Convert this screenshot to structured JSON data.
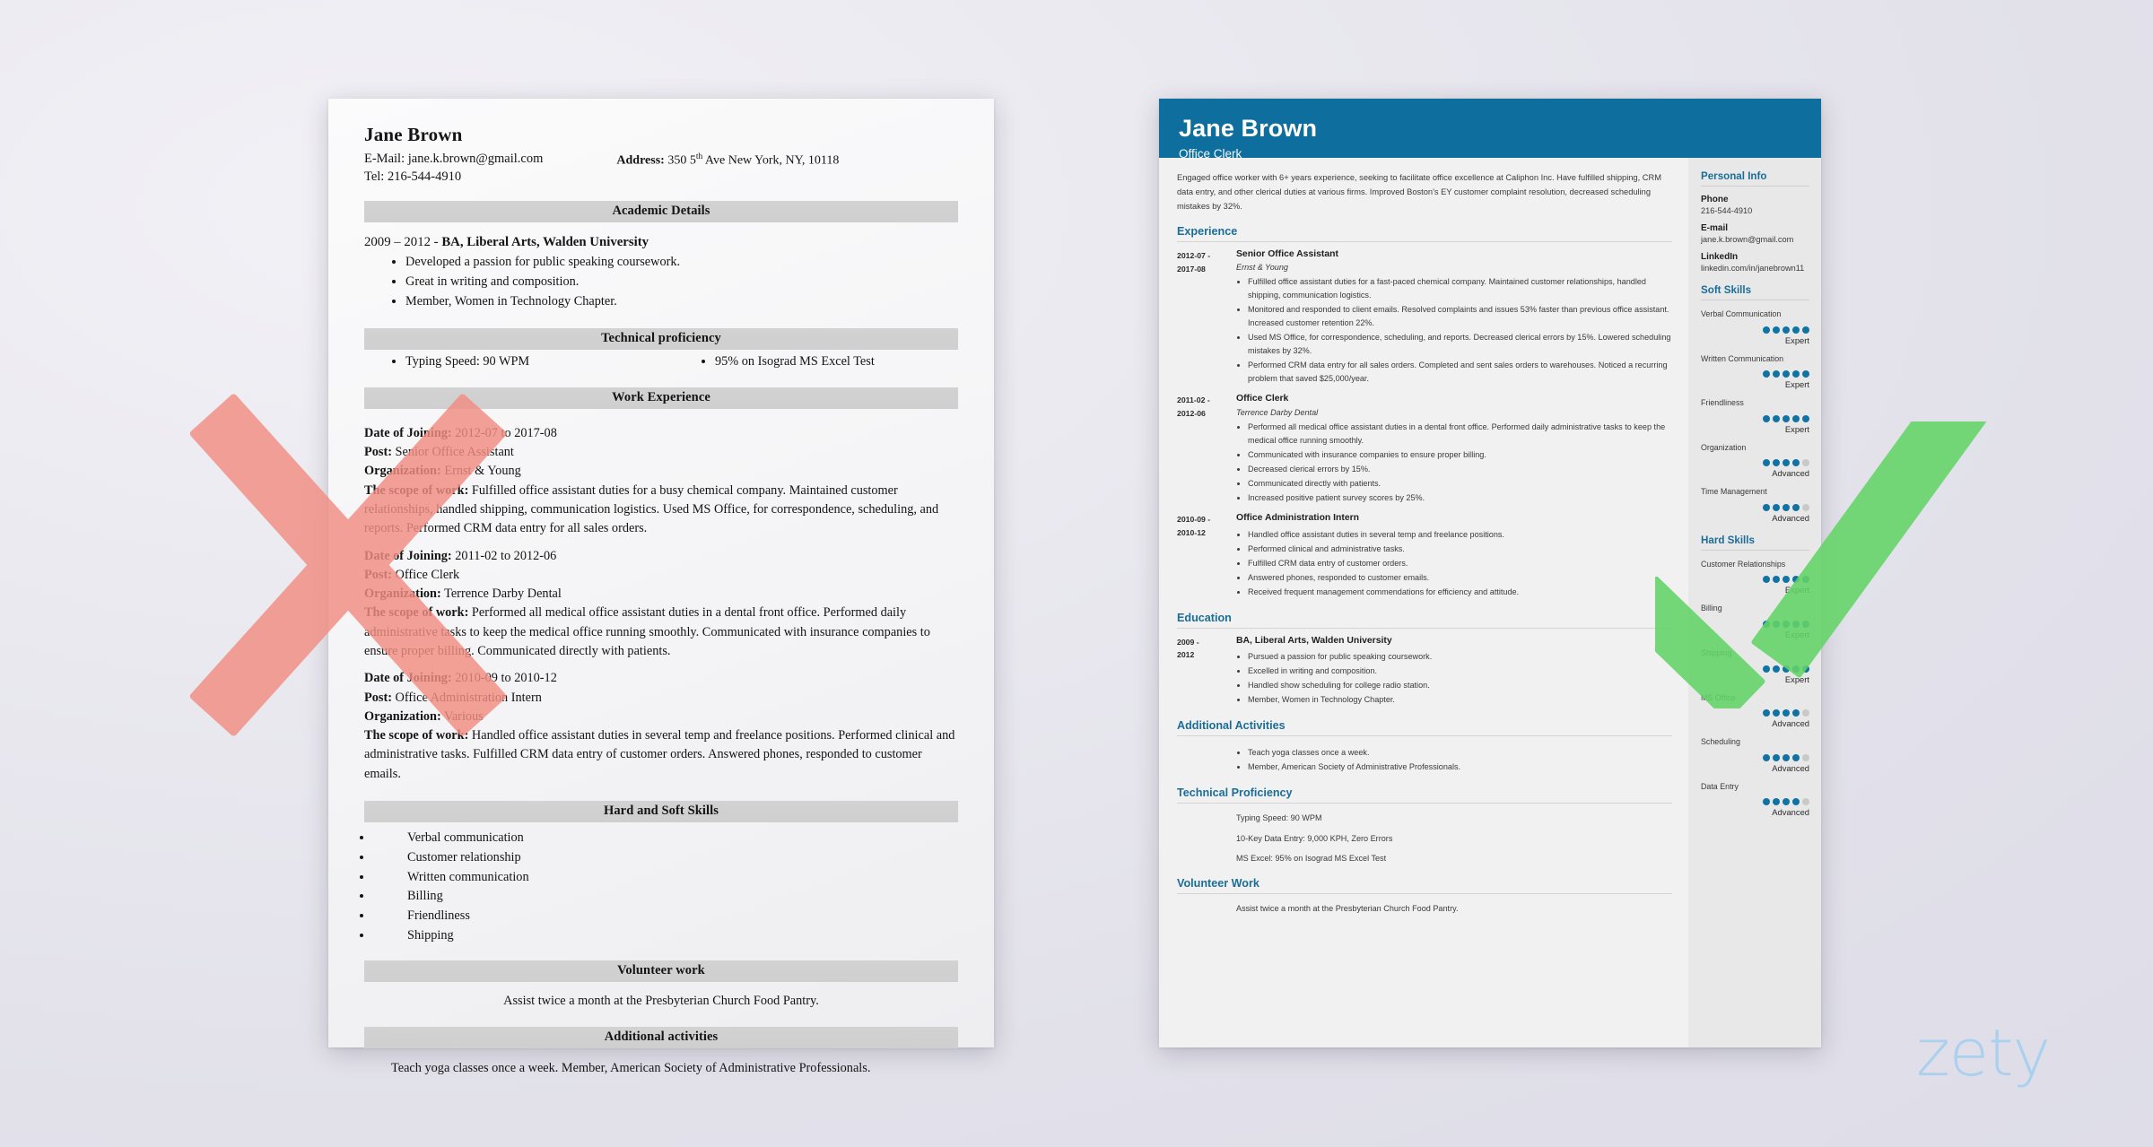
{
  "colors": {
    "header_blue": "#0e6e9e",
    "accent_blue": "#1b6d96",
    "dot_blue": "#1173a4",
    "dot_off": "#c9c9c9",
    "cross_red": "#f28e82",
    "check_green": "#63d467",
    "watermark_blue": "#9bcdef"
  },
  "watermark": {
    "text": "zety"
  },
  "bad_resume": {
    "name": "Jane Brown",
    "email_line": "E-Mail: jane.k.brown@gmail.com",
    "tel_line": "Tel: 216-544-4910",
    "address_label": "Address:",
    "address_value_a": "350 5",
    "address_value_sup": "th",
    "address_value_b": " Ave New York, NY, 10118",
    "sections": {
      "academic": "Academic Details",
      "technical": "Technical proficiency",
      "work": "Work Experience",
      "skills": "Hard and Soft Skills",
      "volunteer": "Volunteer work",
      "additional": "Additional activities"
    },
    "education": {
      "years": "2009 – 2012 - ",
      "degree": "BA, Liberal Arts, Walden University",
      "bullets": [
        "Developed a passion for public speaking coursework.",
        "Great in writing and composition.",
        "Member, Women in Technology Chapter."
      ]
    },
    "technical": {
      "left": [
        "Typing Speed: 90 WPM"
      ],
      "right": [
        "95% on Isograd MS Excel Test"
      ]
    },
    "jobs": [
      {
        "date_label": "Date of Joining:",
        "date_value": " 2012-07 to 2017-08",
        "post_label": "Post:",
        "post_value": " Senior Office Assistant",
        "org_label": "Organization:",
        "org_value": " Ernst & Young",
        "scope_label": "The scope of work:",
        "scope_value": " Fulfilled office assistant duties for a busy chemical company. Maintained customer relationships, handled shipping, communication logistics. Used MS Office, for correspondence, scheduling, and reports. Performed CRM data entry for all sales orders."
      },
      {
        "date_label": "Date of Joining:",
        "date_value": " 2011-02 to 2012-06",
        "post_label": "Post:",
        "post_value": " Office Clerk",
        "org_label": "Organization:",
        "org_value": " Terrence Darby Dental",
        "scope_label": "The scope of work:",
        "scope_value": " Performed all medical office assistant duties in a dental front office. Performed daily administrative tasks to keep the medical office running smoothly. Communicated with insurance companies to ensure proper billing. Communicated directly with patients."
      },
      {
        "date_label": "Date of Joining:",
        "date_value": " 2010-09 to 2010-12",
        "post_label": "Post:",
        "post_value": " Office Administration Intern",
        "org_label": "Organization:",
        "org_value": " Various",
        "scope_label": "The scope of work:",
        "scope_value": " Handled office assistant duties in several temp and freelance positions. Performed clinical and administrative tasks. Fulfilled CRM data entry of customer orders. Answered phones, responded to customer emails."
      }
    ],
    "skills": [
      "Verbal communication",
      "Customer relationship",
      "Written communication",
      "Billing",
      "Friendliness",
      "Shipping"
    ],
    "volunteer_text": "Assist twice a month at the Presbyterian Church Food Pantry.",
    "additional_text": "Teach yoga classes once a week. Member, American Society of Administrative Professionals."
  },
  "good_resume": {
    "name": "Jane Brown",
    "role": "Office Clerk",
    "summary": "Engaged office worker with 6+ years experience, seeking to facilitate office excellence at Caliphon Inc. Have fulfilled shipping, CRM data entry, and other clerical duties at various firms. Improved Boston's EY customer complaint resolution, decreased scheduling mistakes by 32%.",
    "sections": {
      "experience": "Experience",
      "education": "Education",
      "additional_activities": "Additional Activities",
      "technical_proficiency": "Technical Proficiency",
      "volunteer_work": "Volunteer Work"
    },
    "experience": [
      {
        "date_from": "2012-07 -",
        "date_to": "2017-08",
        "title": "Senior Office Assistant",
        "org": "Ernst & Young",
        "bullets": [
          "Fulfilled office assistant duties for a fast-paced chemical company. Maintained customer relationships, handled shipping, communication logistics.",
          "Monitored and responded to client emails. Resolved complaints and issues 53% faster than previous office assistant. Increased customer retention 22%.",
          "Used MS Office, for correspondence, scheduling, and reports. Decreased clerical errors by 15%. Lowered scheduling mistakes by 32%.",
          "Performed CRM data entry for all sales orders. Completed and sent sales orders to warehouses. Noticed a recurring problem that saved $25,000/year."
        ]
      },
      {
        "date_from": "2011-02 -",
        "date_to": "2012-06",
        "title": "Office Clerk",
        "org": "Terrence Darby Dental",
        "bullets": [
          "Performed all medical office assistant duties in a dental front office. Performed daily administrative tasks to keep the medical office running smoothly.",
          "Communicated with insurance companies to ensure proper billing.",
          "Decreased clerical errors by 15%.",
          "Communicated directly with patients.",
          "Increased positive patient survey scores by 25%."
        ]
      },
      {
        "date_from": "2010-09 -",
        "date_to": "2010-12",
        "title": "Office Administration Intern",
        "org": "",
        "bullets": [
          "Handled office assistant duties in several temp and freelance positions.",
          "Performed clinical and administrative tasks.",
          "Fulfilled CRM data entry of customer orders.",
          "Answered phones, responded to customer emails.",
          "Received frequent management commendations for efficiency and attitude."
        ]
      }
    ],
    "education": [
      {
        "date_from": "2009 -",
        "date_to": "2012",
        "title": "BA, Liberal Arts, Walden University",
        "org": "",
        "bullets": [
          "Pursued a passion for public speaking coursework.",
          "Excelled in writing and composition.",
          "Handled show scheduling for college radio station.",
          "Member, Women in Technology Chapter."
        ]
      }
    ],
    "additional_activities": [
      "Teach yoga classes once a week.",
      "Member, American Society of Administrative Professionals."
    ],
    "technical_proficiency": [
      "Typing Speed: 90 WPM",
      "10-Key Data Entry: 9,000 KPH, Zero Errors",
      "MS Excel: 95% on Isograd MS Excel Test"
    ],
    "volunteer_work": [
      "Assist twice a month at the Presbyterian Church Food Pantry."
    ],
    "sidebar": {
      "personal_info_title": "Personal Info",
      "personal_info": [
        {
          "label": "Phone",
          "value": "216-544-4910"
        },
        {
          "label": "E-mail",
          "value": "jane.k.brown@gmail.com"
        },
        {
          "label": "LinkedIn",
          "value": "linkedin.com/in/janebrown11"
        }
      ],
      "soft_skills_title": "Soft Skills",
      "soft_skills": [
        {
          "name": "Verbal Communication",
          "filled": 5,
          "total": 5,
          "level": "Expert"
        },
        {
          "name": "Written Communication",
          "filled": 5,
          "total": 5,
          "level": "Expert"
        },
        {
          "name": "Friendliness",
          "filled": 5,
          "total": 5,
          "level": "Expert"
        },
        {
          "name": "Organization",
          "filled": 4,
          "total": 5,
          "level": "Advanced"
        },
        {
          "name": "Time Management",
          "filled": 4,
          "total": 5,
          "level": "Advanced"
        }
      ],
      "hard_skills_title": "Hard Skills",
      "hard_skills": [
        {
          "name": "Customer Relationships",
          "filled": 5,
          "total": 5,
          "level": "Expert"
        },
        {
          "name": "Billing",
          "filled": 5,
          "total": 5,
          "level": "Expert"
        },
        {
          "name": "Shipping",
          "filled": 5,
          "total": 5,
          "level": "Expert"
        },
        {
          "name": "MS Office",
          "filled": 4,
          "total": 5,
          "level": "Advanced"
        },
        {
          "name": "Scheduling",
          "filled": 4,
          "total": 5,
          "level": "Advanced"
        },
        {
          "name": "Data Entry",
          "filled": 4,
          "total": 5,
          "level": "Advanced"
        }
      ]
    }
  }
}
